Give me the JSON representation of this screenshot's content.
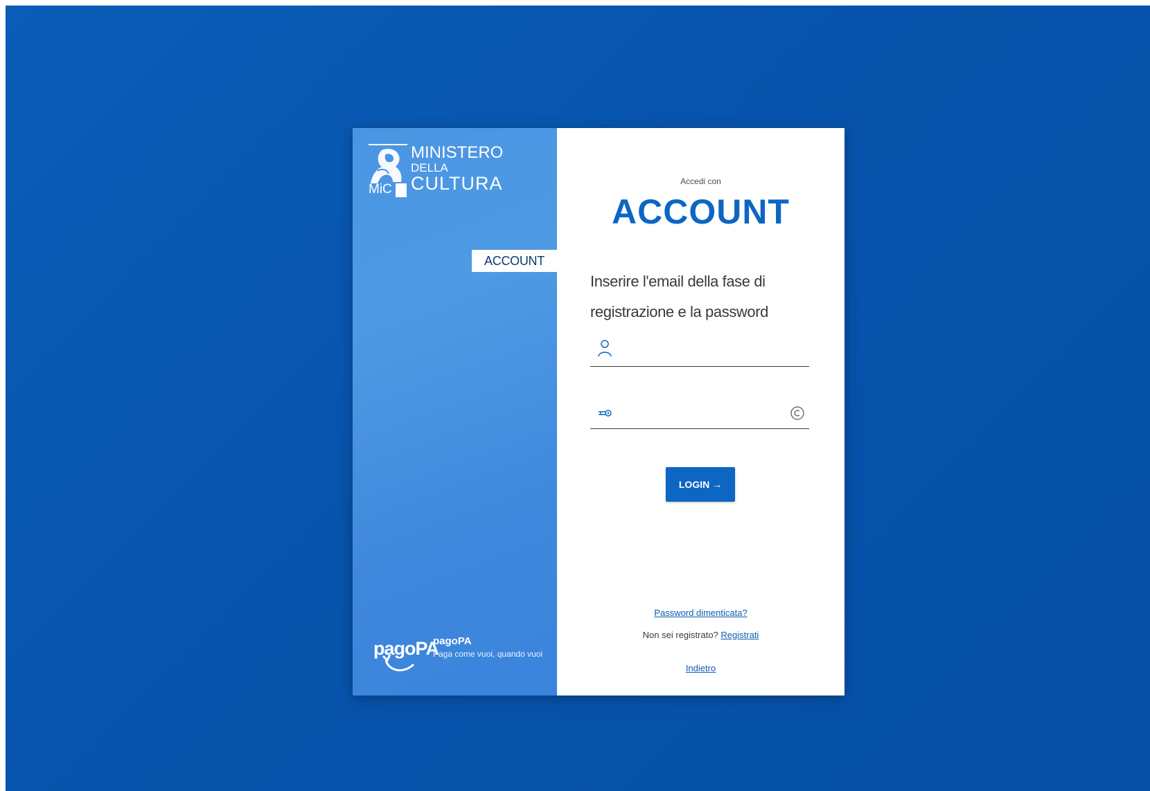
{
  "brand": {
    "ministry_line1": "MINISTERO",
    "ministry_line2": "DELLA",
    "ministry_line3": "CULTURA",
    "ministry_abbr": "MiC"
  },
  "sidebar": {
    "active_tab": "ACCOUNT"
  },
  "login": {
    "accedi_label": "Accedi con",
    "title": "ACCOUNT",
    "instructions_line1": "Inserire l'email della fase di",
    "instructions_line2": "registrazione e la password",
    "email_value": "",
    "password_value": "",
    "login_button": "LOGIN →",
    "forgot_password": "Password dimenticata?",
    "not_registered": "Non sei registrato?",
    "register_link": "Registrati",
    "back_link": "Indietro"
  },
  "pagopa": {
    "logo_text": "pagoPA",
    "name": "pagoPA",
    "tagline": "Paga come vuoi, quando vuoi"
  },
  "colors": {
    "background": "#0753ab",
    "left_panel": "#4a95e3",
    "accent": "#0d66c2"
  }
}
